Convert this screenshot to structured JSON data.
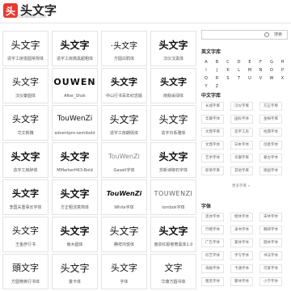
{
  "header": {
    "logo_mark": "头",
    "logo_text": "头文字",
    "logo_sub": "TOUWENZI.COM"
  },
  "cards": [
    {
      "preview": "头文字",
      "name": "造字工房悦圆常规体"
    },
    {
      "preview": "头文字",
      "name": "造字工房典黑超粗体"
    },
    {
      "preview": "·头文字",
      "name": "方圆白鸦体"
    },
    {
      "preview": "头文字",
      "name": "汉仪汉黑体"
    },
    {
      "preview": "头文字",
      "name": "汉仪秦圆体"
    },
    {
      "preview": "OUWEN",
      "name": "After_Shok"
    },
    {
      "preview": "头文字",
      "name": "中山行书百年纪念版"
    },
    {
      "preview": "头文字",
      "name": "南梨采绿体"
    },
    {
      "preview": "头文字",
      "name": "华文新魏"
    },
    {
      "preview": "TouWenZi",
      "name": "adventpro-semibold"
    },
    {
      "preview": "头文字",
      "name": "造字工房朗倩体"
    },
    {
      "preview": "头文字",
      "name": "造字日系雅体"
    },
    {
      "preview": "头文字",
      "name": "造字工房醉体"
    },
    {
      "preview": "头文字",
      "name": "MMarkerHK3-Bold"
    },
    {
      "preview": "TouWenZi",
      "name": "Gasalt字体"
    },
    {
      "preview": "头文字",
      "name": "苏新诗柳石字体"
    },
    {
      "preview": "头文字",
      "name": "李国夫重事长字体"
    },
    {
      "preview": "头文字",
      "name": "方正粗活意简体"
    },
    {
      "preview": "TouWenZi",
      "name": "White字体"
    },
    {
      "preview": "TOUWENZI",
      "name": "lombok字体"
    },
    {
      "preview": "头文字",
      "name": "王金彦行书"
    },
    {
      "preview": "头文字",
      "name": "雨木圆体"
    },
    {
      "preview": "头文字",
      "name": "腾祥鸿悦体"
    },
    {
      "preview": "头文字",
      "name": "南宗红颜卷筒黑体1.0"
    },
    {
      "preview": "頭文字",
      "name": "方圆筷爽行书体"
    },
    {
      "preview": "头文字",
      "name": "童卡体"
    },
    {
      "preview": "头文字",
      "name": "字体"
    },
    {
      "preview": "文字",
      "name": "华康方圆书体"
    }
  ],
  "sidebar": {
    "search_button": "搜索",
    "english_title": "英文字库",
    "letters": [
      "A",
      "B",
      "C",
      "D",
      "E",
      "F",
      "G",
      "H",
      "I",
      "J",
      "K",
      "L",
      "M",
      "N",
      "O",
      "P",
      "Q",
      "R",
      "S",
      "T",
      "U",
      "V",
      "W",
      "X",
      "Y",
      "Z"
    ],
    "chinese_title": "中文字库",
    "chinese_tags": [
      "长城字库",
      "汉仪字库",
      "方正字库",
      "华康字体",
      "国标字体",
      "金梅字库",
      "文鼎字库",
      "造字工房",
      "经典字体",
      "文鼎字体",
      "日本字体",
      "创意字体",
      "艺术字体",
      "华康字库",
      "蒙古字体",
      "新蒂字库",
      "其他字库",
      "德国字体"
    ],
    "more_label": "更多字库 »",
    "font_title": "字体",
    "font_tags": [
      "黑体字体",
      "楷体字体",
      "宋体字体",
      "行楷字体",
      "隶书字体",
      "魏碑字体",
      "广告字体",
      "篆体字体",
      "圆体字体",
      "综艺字体",
      "手写字体",
      "书法字体",
      "海报字体",
      "卡通字体",
      "可爱字体",
      "粗黑字体",
      "繁体字体",
      "小学字体"
    ]
  }
}
